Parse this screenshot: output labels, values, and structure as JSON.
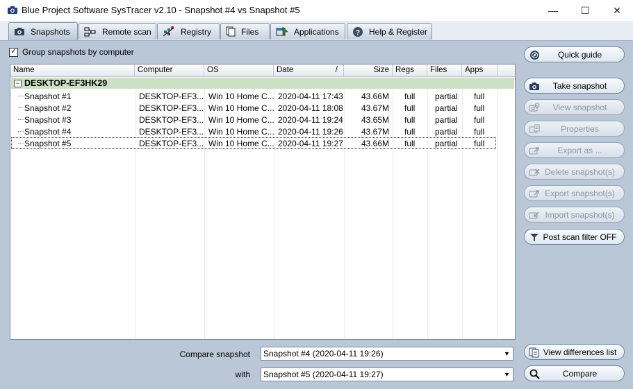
{
  "window": {
    "title": "Blue Project Software SysTracer v2.10 - Snapshot #4 vs Snapshot #5",
    "minimize_glyph": "—",
    "maximize_glyph": "☐",
    "close_glyph": "✕"
  },
  "tabs": [
    {
      "label": "Snapshots",
      "icon": "camera-icon",
      "active": true
    },
    {
      "label": "Remote scan",
      "icon": "network-icon",
      "active": false
    },
    {
      "label": "Registry",
      "icon": "registry-icon",
      "active": false
    },
    {
      "label": "Files",
      "icon": "files-icon",
      "active": false
    },
    {
      "label": "Applications",
      "icon": "applications-icon",
      "active": false
    },
    {
      "label": "Help & Register",
      "icon": "help-icon",
      "active": false
    }
  ],
  "group_checkbox": {
    "label": "Group snapshots by computer",
    "checked": true
  },
  "list": {
    "columns": [
      "Name",
      "Computer",
      "OS",
      "Date",
      "Size",
      "Regs",
      "Files",
      "Apps"
    ],
    "sort_indicator": "/",
    "group": {
      "name": "DESKTOP-EF3HK29",
      "expander": "−"
    },
    "rows": [
      {
        "name": "Snapshot #1",
        "computer": "DESKTOP-EF3...",
        "os": "Win 10 Home C...",
        "date": "2020-04-11 17:43",
        "size": "43.66M",
        "regs": "full",
        "files": "partial",
        "apps": "full"
      },
      {
        "name": "Snapshot #2",
        "computer": "DESKTOP-EF3...",
        "os": "Win 10 Home C...",
        "date": "2020-04-11 18:08",
        "size": "43.67M",
        "regs": "full",
        "files": "partial",
        "apps": "full"
      },
      {
        "name": "Snapshot #3",
        "computer": "DESKTOP-EF3...",
        "os": "Win 10 Home C...",
        "date": "2020-04-11 19:24",
        "size": "43.65M",
        "regs": "full",
        "files": "partial",
        "apps": "full"
      },
      {
        "name": "Snapshot #4",
        "computer": "DESKTOP-EF3...",
        "os": "Win 10 Home C...",
        "date": "2020-04-11 19:26",
        "size": "43.67M",
        "regs": "full",
        "files": "partial",
        "apps": "full"
      },
      {
        "name": "Snapshot #5",
        "computer": "DESKTOP-EF3...",
        "os": "Win 10 Home C...",
        "date": "2020-04-11 19:27",
        "size": "43.66M",
        "regs": "full",
        "files": "partial",
        "apps": "full"
      }
    ]
  },
  "side_buttons": [
    {
      "label": "Quick guide",
      "icon": "guide-icon",
      "enabled": true
    },
    {
      "label": "Take snapshot",
      "icon": "camera-icon",
      "enabled": true
    },
    {
      "label": "View snapshot",
      "icon": "view-icon",
      "enabled": false
    },
    {
      "label": "Properties",
      "icon": "properties-icon",
      "enabled": false
    },
    {
      "label": "Export as ...",
      "icon": "export-icon",
      "enabled": false
    },
    {
      "label": "Delete snapshot(s)",
      "icon": "delete-icon",
      "enabled": false
    },
    {
      "label": "Export snapshot(s)",
      "icon": "export-icon",
      "enabled": false
    },
    {
      "label": "Import snapshot(s)",
      "icon": "import-icon",
      "enabled": false
    },
    {
      "label": "Post scan filter OFF",
      "icon": "filter-icon",
      "enabled": true
    }
  ],
  "compare": {
    "snapshot_label": "Compare snapshot",
    "snapshot_value": "Snapshot #4 (2020-04-11 19:26)",
    "with_label": "with",
    "with_value": "Snapshot #5 (2020-04-11 19:27)",
    "arrow_glyph": "▼",
    "view_differences_label": "View differences list",
    "compare_label": "Compare"
  },
  "colors": {
    "group_row_bg": "#cde0c4",
    "panel_bg": "#b9c7d6"
  }
}
